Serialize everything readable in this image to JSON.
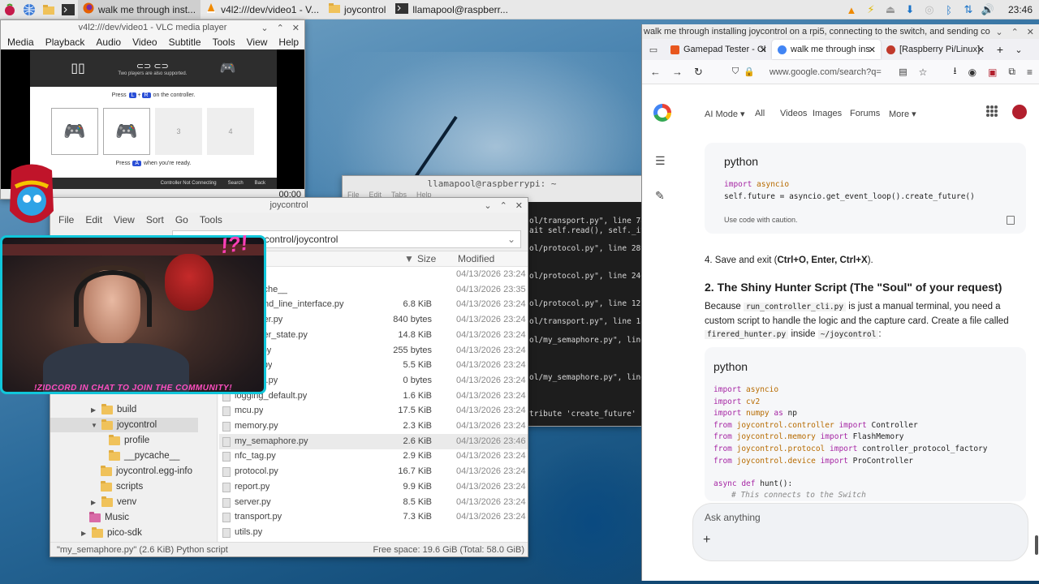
{
  "taskbar": {
    "tasks": [
      {
        "label": "walk me through inst..."
      },
      {
        "label": "v4l2:///dev/video1 - V..."
      },
      {
        "label": "joycontrol"
      },
      {
        "label": "llamapool@raspberr..."
      }
    ],
    "clock": "23:46"
  },
  "vlc": {
    "title": "v4l2:///dev/video1 - VLC media player",
    "menu": [
      "Media",
      "Playback",
      "Audio",
      "Video",
      "Subtitle",
      "Tools",
      "View",
      "Help"
    ],
    "time": "00:00",
    "switch": {
      "top_note": "Two players are also supported.",
      "press_prefix": "Press",
      "key_l": "L",
      "plus": "+",
      "key_r": "R",
      "press_suffix": "on the controller.",
      "slot3": "3",
      "slot4": "4",
      "ready_prefix": "Press",
      "key_a": "A",
      "ready_suffix": "when you're ready.",
      "footer_status": "Controller Not Connecting",
      "footer_search": "Search",
      "footer_back": "Back"
    }
  },
  "terminal": {
    "title": "llamapool@raspberrypi: ~",
    "menu": [
      "File",
      "Edit",
      "Tabs",
      "Help"
    ],
    "lines": [
      "ol/transport.py\", line 78,",
      "ait self.read(), self._itr",
      "ol/protocol.py\", line 289,",
      "ol/protocol.py\", line 246,",
      "ol/protocol.py\", line 127,",
      "ol/transport.py\", line 183",
      "ol/my_semaphore.py\", line",
      "ol/my_semaphore.py\", line",
      "tribute 'create_future'"
    ]
  },
  "filemanager": {
    "title": "joycontrol",
    "menu": [
      "File",
      "Edit",
      "View",
      "Sort",
      "Go",
      "Tools"
    ],
    "path": "/home/llamapool/joycontrol/joycontrol",
    "columns": {
      "size": "Size",
      "modified": "Modified"
    },
    "tree": [
      {
        "label": "build"
      },
      {
        "label": "joycontrol"
      },
      {
        "label": "profile"
      },
      {
        "label": "__pycache__"
      },
      {
        "label": "joycontrol.egg-info"
      },
      {
        "label": "scripts"
      },
      {
        "label": "venv"
      },
      {
        "label": "Music"
      },
      {
        "label": "pico-sdk"
      }
    ],
    "files": [
      {
        "name": "",
        "size": "",
        "modified": "04/13/2026 23:24"
      },
      {
        "name": "__pycache__",
        "size": "",
        "modified": "04/13/2026 23:35"
      },
      {
        "name": "command_line_interface.py",
        "size": "6.8 KiB",
        "modified": "04/13/2026 23:24"
      },
      {
        "name": "controller.py",
        "size": "840 bytes",
        "modified": "04/13/2026 23:24"
      },
      {
        "name": "controller_state.py",
        "size": "14.8 KiB",
        "modified": "04/13/2026 23:24"
      },
      {
        "name": "debug.py",
        "size": "255 bytes",
        "modified": "04/13/2026 23:24"
      },
      {
        "name": "device.py",
        "size": "5.5 KiB",
        "modified": "04/13/2026 23:24"
      },
      {
        "name": "__init__.py",
        "size": "0 bytes",
        "modified": "04/13/2026 23:24"
      },
      {
        "name": "logging_default.py",
        "size": "1.6 KiB",
        "modified": "04/13/2026 23:24"
      },
      {
        "name": "mcu.py",
        "size": "17.5 KiB",
        "modified": "04/13/2026 23:24"
      },
      {
        "name": "memory.py",
        "size": "2.3 KiB",
        "modified": "04/13/2026 23:24"
      },
      {
        "name": "my_semaphore.py",
        "size": "2.6 KiB",
        "modified": "04/13/2026 23:46"
      },
      {
        "name": "nfc_tag.py",
        "size": "2.9 KiB",
        "modified": "04/13/2026 23:24"
      },
      {
        "name": "protocol.py",
        "size": "16.7 KiB",
        "modified": "04/13/2026 23:24"
      },
      {
        "name": "report.py",
        "size": "9.9 KiB",
        "modified": "04/13/2026 23:24"
      },
      {
        "name": "server.py",
        "size": "8.5 KiB",
        "modified": "04/13/2026 23:24"
      },
      {
        "name": "transport.py",
        "size": "7.3 KiB",
        "modified": "04/13/2026 23:24"
      },
      {
        "name": "utils.py",
        "size": "",
        "modified": ""
      }
    ],
    "status_left": "\"my_semaphore.py\" (2.6 KiB) Python script",
    "status_right": "Free space: 19.6 GiB (Total: 58.0 GiB)"
  },
  "webcam": {
    "banner": "!ZIDCORD IN CHAT TO JOIN THE COMMUNITY!",
    "sticker": "!?!"
  },
  "firefox": {
    "window_title": "walk me through installing joycontrol on a rpi5, connecting to the switch, and sending com...",
    "tabs": [
      {
        "label": "Gamepad Tester - Cl",
        "color": "#e8571f"
      },
      {
        "label": "walk me through ins",
        "color": "#4285f4"
      },
      {
        "label": "[Raspberry Pi/Linux]",
        "color": "#c0392b"
      }
    ],
    "url": "www.google.com/search?q=",
    "google_tabs": [
      "AI Mode",
      "All",
      "Videos",
      "Images",
      "Forums",
      "More"
    ],
    "block1": {
      "lang": "python",
      "lines": [
        {
          "kw": "import",
          "rest": " asyncio"
        },
        {
          "kw": "",
          "rest": "self.future = asyncio.get_event_loop().create_future()"
        }
      ],
      "caution": "Use code with caution."
    },
    "step4_prefix": "4. Save and exit (",
    "step4_bold": "Ctrl+O, Enter, Ctrl+X",
    "step4_suffix": ").",
    "heading": "2. The Shiny Hunter Script (The \"Soul\" of your request)",
    "para_because": "Because",
    "para_code1": "run_controller_cli.py",
    "para_mid": "is just a manual terminal, you need a custom script to handle the logic and the capture card. Create a file called",
    "para_code2": "firered_hunter.py",
    "para_inside": "inside",
    "para_code3": "~/joycontrol",
    "para_end": ":",
    "block2": {
      "lang": "python",
      "lines": [
        {
          "a": "import",
          "b": " asyncio",
          "c": "",
          "d": ""
        },
        {
          "a": "import",
          "b": " cv2",
          "c": "",
          "d": ""
        },
        {
          "a": "import",
          "b": " numpy ",
          "c": "as",
          "d": " np"
        },
        {
          "a": "from",
          "b": " joycontrol.controller ",
          "c": "import",
          "d": " Controller"
        },
        {
          "a": "from",
          "b": " joycontrol.memory ",
          "c": "import",
          "d": " FlashMemory"
        },
        {
          "a": "from",
          "b": " joycontrol.protocol ",
          "c": "import",
          "d": " controller_protocol_factory"
        },
        {
          "a": "from",
          "b": " joycontrol.device ",
          "c": "import",
          "d": " ProController"
        }
      ],
      "def_kw": "async def",
      "def_rest": " hunt():",
      "comment": "# This connects to the Switch"
    },
    "ask_placeholder": "Ask anything"
  }
}
